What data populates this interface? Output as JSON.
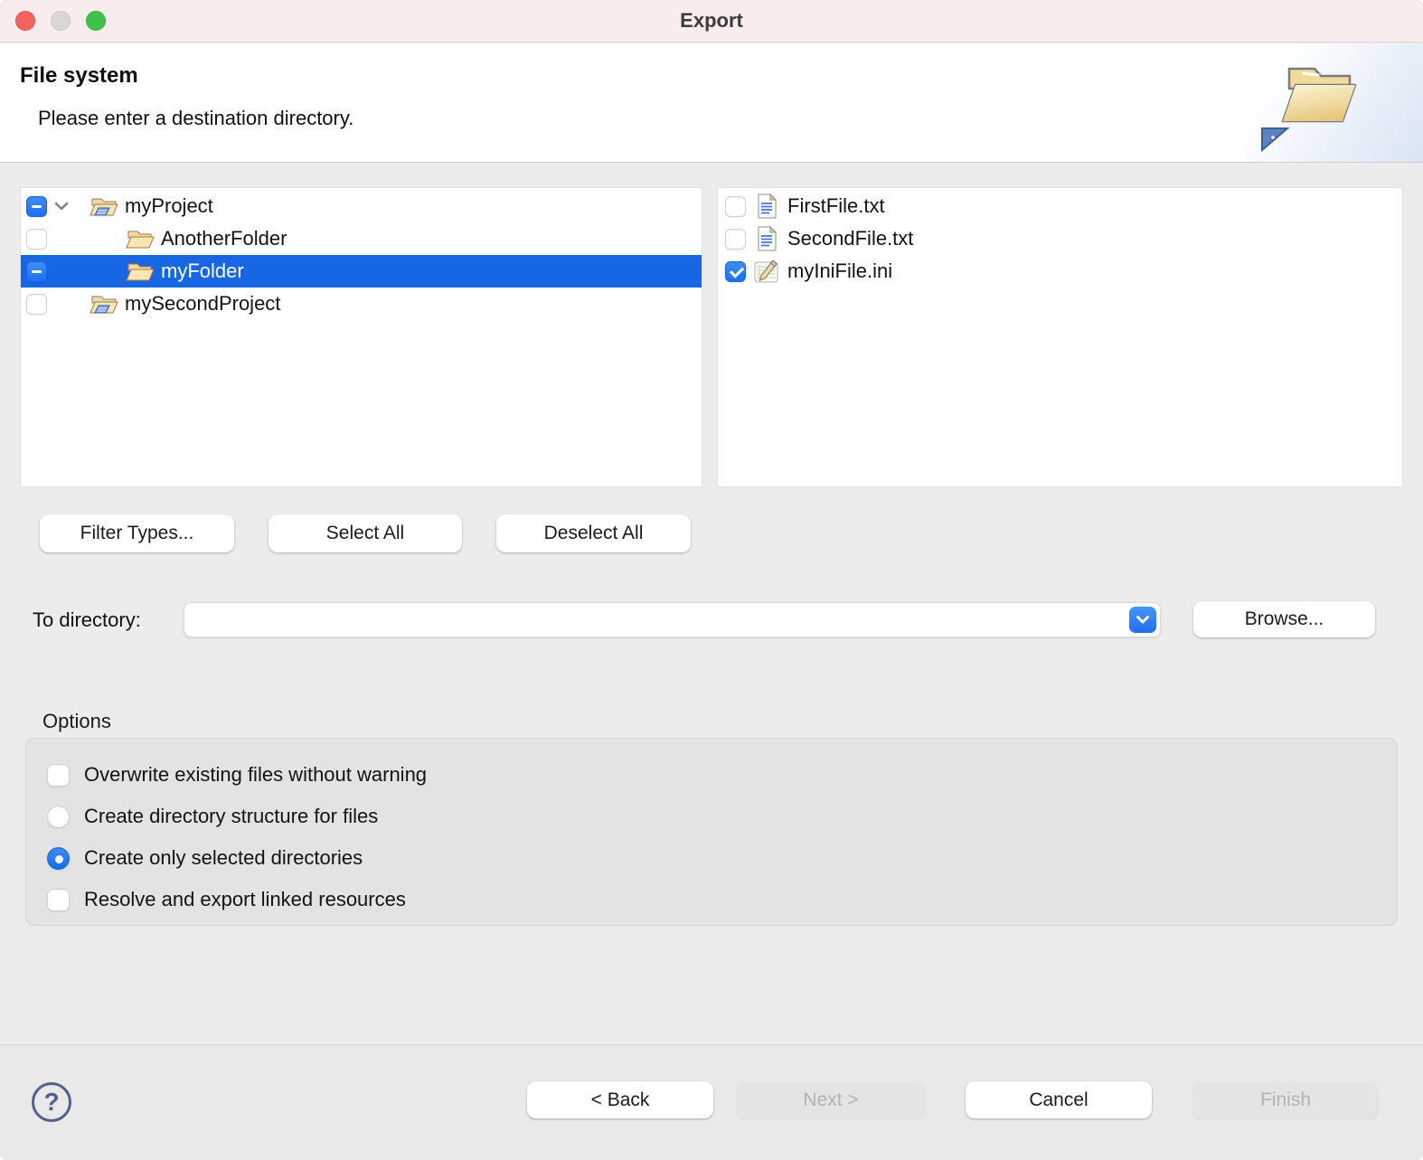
{
  "window": {
    "title": "Export",
    "traffic_lights": [
      "close",
      "minimize-disabled",
      "zoom"
    ]
  },
  "header": {
    "title": "File system",
    "message": "Please enter a destination directory.",
    "banner_icon": "open-folder-export-icon"
  },
  "tree": {
    "items": [
      {
        "label": "myProject",
        "icon": "project-folder-icon",
        "checkbox": "mixed",
        "level": 0,
        "expanded": true,
        "selected": false
      },
      {
        "label": "AnotherFolder",
        "icon": "folder-icon",
        "checkbox": "unchecked",
        "level": 1,
        "selected": false
      },
      {
        "label": "myFolder",
        "icon": "folder-icon",
        "checkbox": "mixed",
        "level": 1,
        "selected": true
      },
      {
        "label": "mySecondProject",
        "icon": "project-folder-icon",
        "checkbox": "unchecked",
        "level": 0,
        "selected": false
      }
    ]
  },
  "files": {
    "items": [
      {
        "label": "FirstFile.txt",
        "icon": "text-file-icon",
        "checkbox": "unchecked"
      },
      {
        "label": "SecondFile.txt",
        "icon": "text-file-icon",
        "checkbox": "unchecked"
      },
      {
        "label": "myIniFile.ini",
        "icon": "ini-file-icon",
        "checkbox": "checked"
      }
    ]
  },
  "actions": {
    "filter_types": "Filter Types...",
    "select_all": "Select All",
    "deselect_all": "Deselect All"
  },
  "destination": {
    "label": "To directory:",
    "value": "",
    "browse": "Browse..."
  },
  "options": {
    "label": "Options",
    "items": [
      {
        "type": "checkbox",
        "state": "unchecked",
        "label": "Overwrite existing files without warning"
      },
      {
        "type": "radio",
        "state": "unchecked",
        "label": "Create directory structure for files"
      },
      {
        "type": "radio",
        "state": "checked",
        "label": "Create only selected directories"
      },
      {
        "type": "checkbox",
        "state": "unchecked",
        "label": "Resolve and export linked resources"
      }
    ]
  },
  "footer": {
    "help": "?",
    "back": "< Back",
    "next": "Next >",
    "cancel": "Cancel",
    "finish": "Finish",
    "back_enabled": true,
    "next_enabled": false,
    "cancel_enabled": true,
    "finish_enabled": false
  },
  "colors": {
    "selection": "#1767e5",
    "accent": "#2781f3",
    "titlebar": "#f9ecec",
    "header_bg": "#ffffff",
    "page_bg": "#ececec"
  }
}
